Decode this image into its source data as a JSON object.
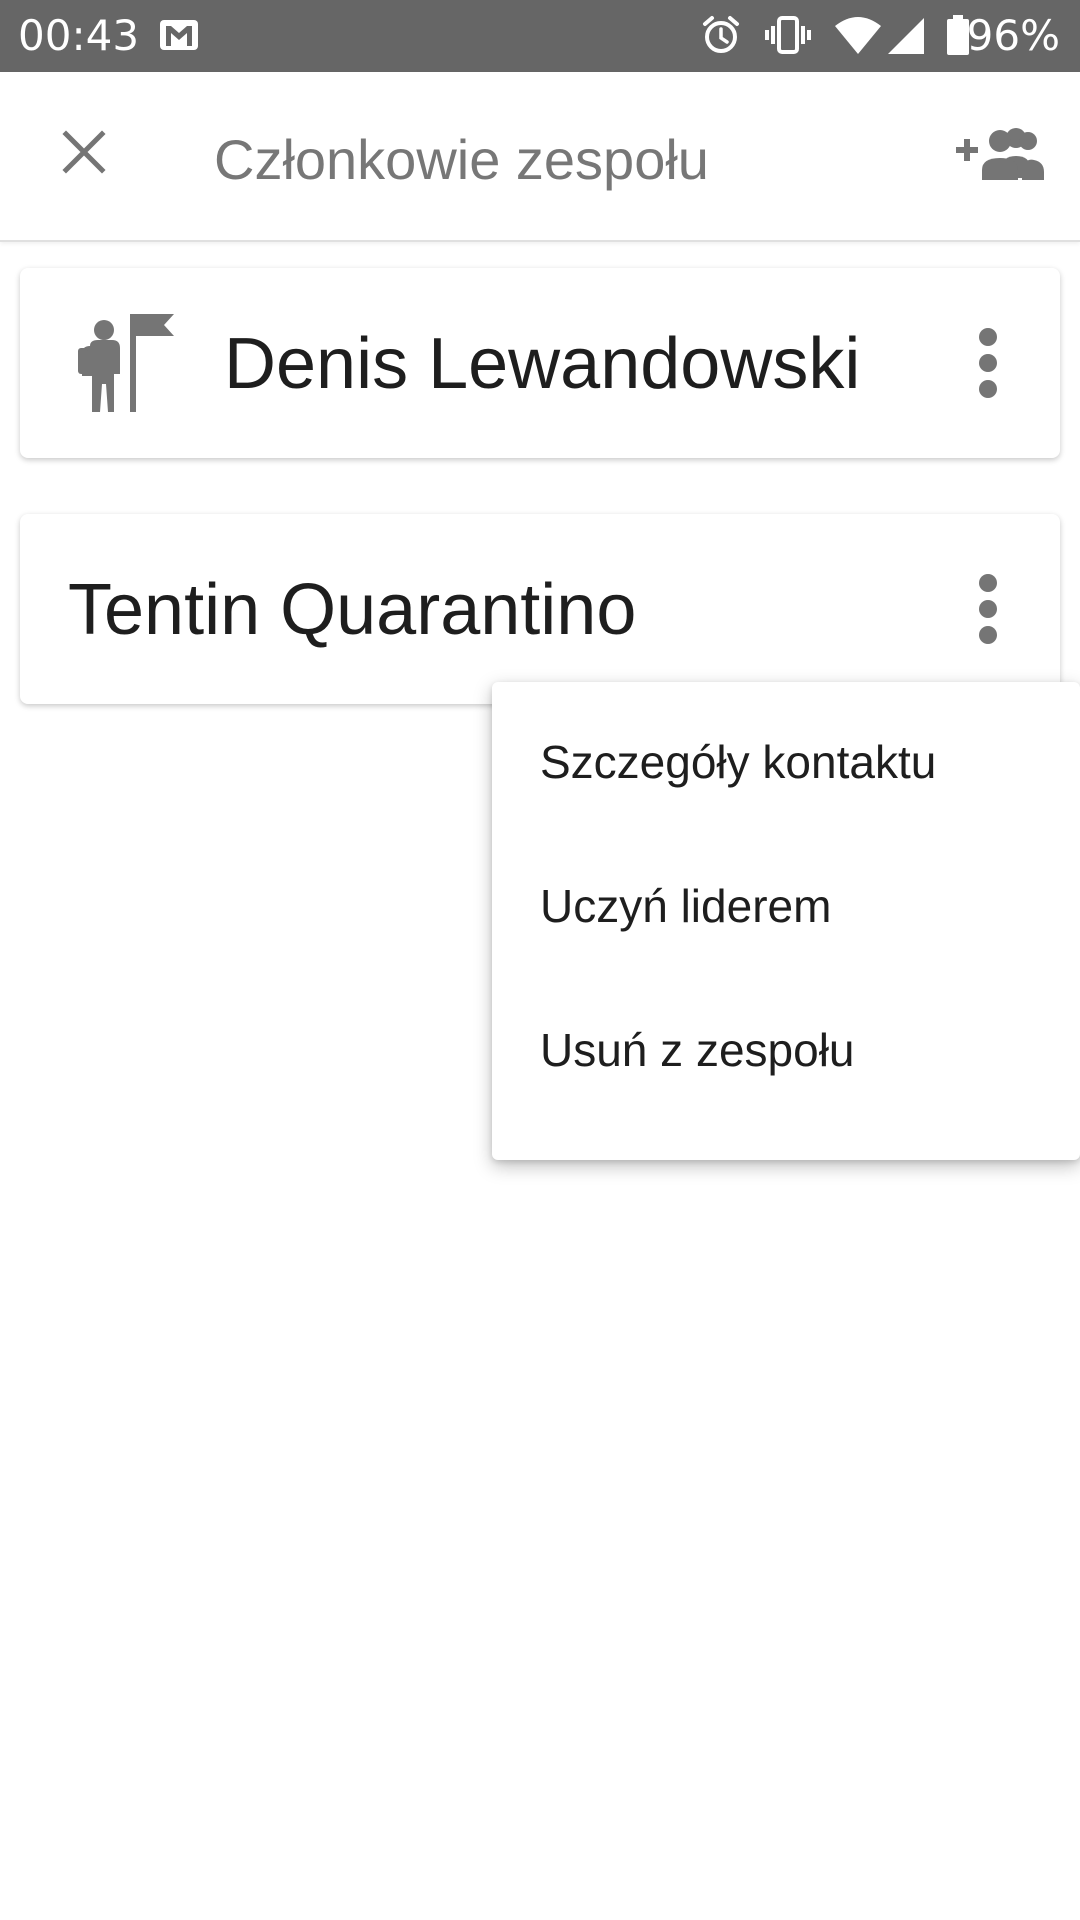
{
  "status_bar": {
    "time": "00:43",
    "battery": "96%",
    "icons": [
      "gmail-icon",
      "alarm-icon",
      "vibrate-icon",
      "wifi-icon",
      "signal-icon",
      "battery-icon"
    ]
  },
  "app_bar": {
    "title": "Członkowie zespołu",
    "close_icon": "close-icon",
    "add_icon": "group-add-icon"
  },
  "members": [
    {
      "name": "Denis Lewandowski",
      "is_leader": true,
      "icon": "leader-flag-icon"
    },
    {
      "name": "Tentin Quarantino",
      "is_leader": false
    }
  ],
  "menu": {
    "items": [
      "Szczegóły kontaktu",
      "Uczyń liderem",
      "Usuń z zespołu"
    ]
  },
  "colors": {
    "status_bar_bg": "#666666",
    "icon_gray": "#757575",
    "text_dark": "#1e1e1e",
    "title_gray": "#777777"
  }
}
